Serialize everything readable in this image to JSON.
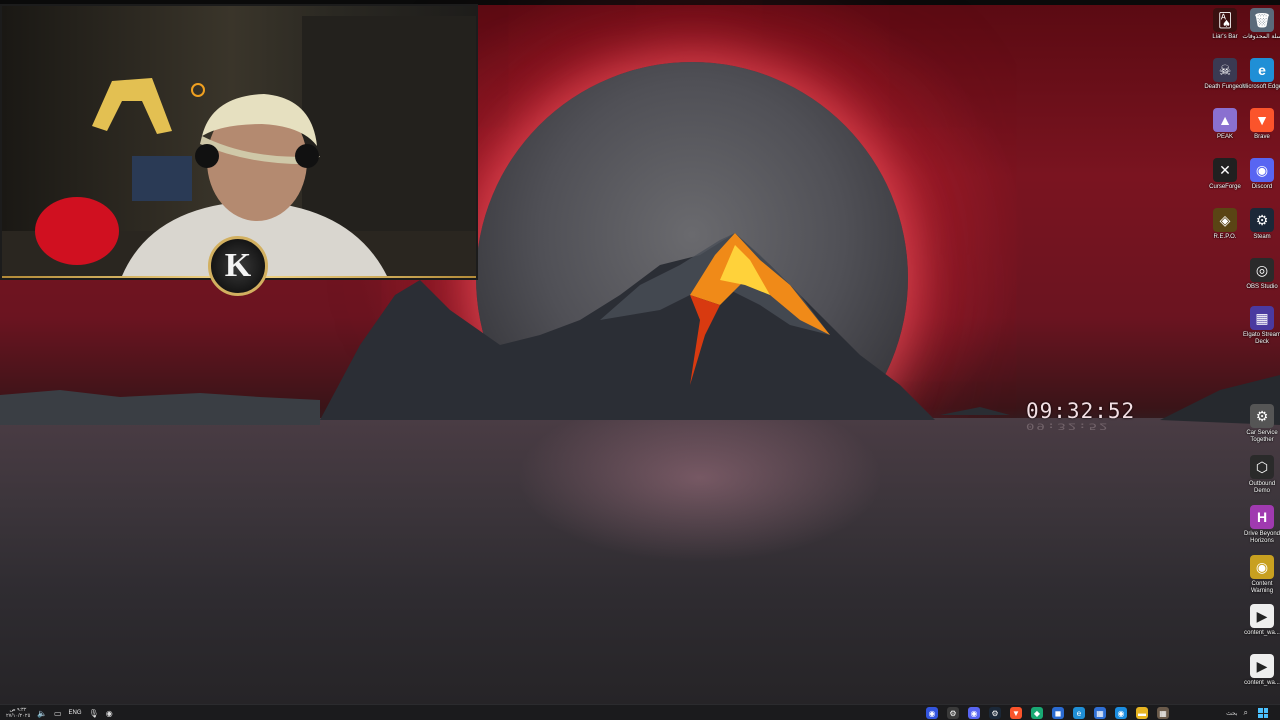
{
  "desktop": {
    "clock_text": "09:32:52",
    "webcam_logo_letter": "K"
  },
  "icons": [
    {
      "label": "سلة المحذوفات",
      "glyph": "🗑",
      "color": "#5a6a7a"
    },
    {
      "label": "Liar's Bar",
      "glyph": "🂡",
      "color": "#3a1010"
    },
    {
      "label": "Microsoft Edge",
      "glyph": "e",
      "color": "#1f8fd6"
    },
    {
      "label": "Death Fungeon",
      "glyph": "☠",
      "color": "#3a3a52"
    },
    {
      "label": "Brave",
      "glyph": "▼",
      "color": "#fb542b"
    },
    {
      "label": "PEAK",
      "glyph": "▲",
      "color": "#8a70d0"
    },
    {
      "label": "Discord",
      "glyph": "◉",
      "color": "#5865f2"
    },
    {
      "label": "CurseForge",
      "glyph": "✕",
      "color": "#202020"
    },
    {
      "label": "Steam",
      "glyph": "⚙",
      "color": "#1b2838"
    },
    {
      "label": "R.E.P.O.",
      "glyph": "◈",
      "color": "#5a4414"
    },
    {
      "label": "OBS Studio",
      "glyph": "◎",
      "color": "#2a2a2a"
    },
    {
      "label": "Elgato Stream Deck",
      "glyph": "▦",
      "color": "#4a3aa0"
    },
    {
      "label": "Car Service Together",
      "glyph": "⚙",
      "color": "#555555"
    },
    {
      "label": "Outbound Demo",
      "glyph": "⬡",
      "color": "#2a2a2a"
    },
    {
      "label": "Drive Beyond Horizons",
      "glyph": "H",
      "color": "#a03ab0"
    },
    {
      "label": "Content Warning",
      "glyph": "◉",
      "color": "#c8a020"
    },
    {
      "label": "content_wa...",
      "glyph": "▶",
      "color": "#eeeeee"
    },
    {
      "label": "content_wa...",
      "glyph": "▶",
      "color": "#eeeeee"
    }
  ],
  "taskbar": {
    "date_text": "٩:٣٢ ص ٢٧/١٠/٢٠٢٥",
    "language": "ENG",
    "search_text": "بحث",
    "start_label": "start",
    "task_icons": [
      {
        "name": "taskbar-app-1",
        "glyph": "◉",
        "color": "#3355dd"
      },
      {
        "name": "taskbar-app-2",
        "glyph": "⚙",
        "color": "#3a3a3a"
      },
      {
        "name": "taskbar-discord",
        "glyph": "◉",
        "color": "#5865f2"
      },
      {
        "name": "taskbar-steam",
        "glyph": "⚙",
        "color": "#1b2838"
      },
      {
        "name": "taskbar-brave",
        "glyph": "▼",
        "color": "#fb542b"
      },
      {
        "name": "taskbar-app-6",
        "glyph": "◆",
        "color": "#19a974"
      },
      {
        "name": "taskbar-app-7",
        "glyph": "◼",
        "color": "#2a6bd1"
      },
      {
        "name": "taskbar-edge",
        "glyph": "e",
        "color": "#1f8fd6"
      },
      {
        "name": "taskbar-store",
        "glyph": "▦",
        "color": "#2f6fd4"
      },
      {
        "name": "taskbar-app-10",
        "glyph": "◉",
        "color": "#1b8de0"
      },
      {
        "name": "taskbar-explorer",
        "glyph": "▬",
        "color": "#e6b422"
      },
      {
        "name": "taskbar-app-12",
        "glyph": "▦",
        "color": "#6a5a4a"
      }
    ]
  }
}
